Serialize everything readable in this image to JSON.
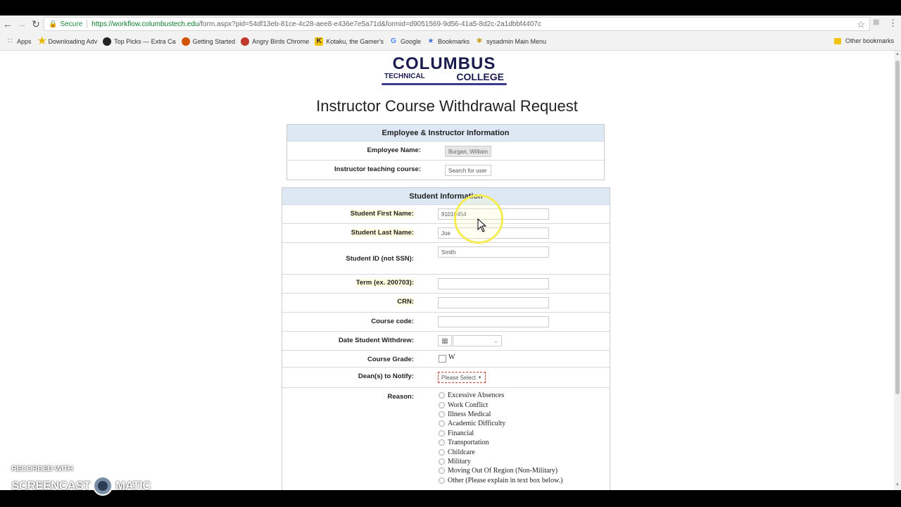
{
  "browser": {
    "secure_label": "Secure",
    "url_main": "https://workflow.columbustech.edu",
    "url_rest": "/form.aspx?pid=54df13eb-81ce-4c28-aee8-e436e7e5a71d&formid=d9051569-9d56-41a5-8d2c-2a1dbbf4407c",
    "bookmarks": [
      {
        "label": "Apps",
        "icon": "apps-grid-icon"
      },
      {
        "label": "Downloading Adv",
        "icon": "star-icon"
      },
      {
        "label": "Top Picks — Extra Ca",
        "icon": "circle-icon"
      },
      {
        "label": "Getting Started",
        "icon": "firefox-icon"
      },
      {
        "label": "Angry Birds Chrome",
        "icon": "bird-icon"
      },
      {
        "label": "Kotaku, the Gamer's",
        "icon": "kotaku-icon"
      },
      {
        "label": "Google",
        "icon": "google-icon"
      },
      {
        "label": "Bookmarks",
        "icon": "star-icon"
      },
      {
        "label": "sysadmin Main Menu",
        "icon": "sysadmin-icon"
      }
    ],
    "other_bookmarks": "Other bookmarks"
  },
  "logo": {
    "top": "COLUMBUS",
    "left": "TECHNICAL",
    "right": "COLLEGE"
  },
  "title": "Instructor Course Withdrawal Request",
  "employee_section": {
    "heading": "Employee & Instructor Information",
    "employee_name_label": "Employee Name:",
    "employee_name_value": "Burgan, William",
    "instructor_label": "Instructor teaching course:",
    "instructor_placeholder": "Search for user"
  },
  "student_section": {
    "heading": "Student Information",
    "first_name_label": "Student First Name:",
    "first_name_value": "91010454",
    "last_name_label": "Student Last Name:",
    "last_name_value": "Joe",
    "student_id_label": "Student ID (not SSN):",
    "student_id_value": "Smith",
    "term_label": "Term (ex. 200703):",
    "crn_label": "CRN:",
    "course_code_label": "Course code:",
    "date_withdrew_label": "Date Student Withdrew:",
    "course_grade_label": "Course Grade:",
    "course_grade_option": "W",
    "deans_label": "Dean(s) to Notify:",
    "deans_placeholder": "Please Select",
    "reason_label": "Reason:",
    "reasons": [
      "Excessive Absences",
      "Work Conflict",
      "Illness Medical",
      "Academic Difficulty",
      "Financial",
      "Transportation",
      "Childcare",
      "Military",
      "Moving Out Of Region (Non-Military)",
      "Other (Please explain in text box below.)"
    ]
  },
  "watermark": {
    "line1": "RECORDED WITH",
    "left": "SCREENCAST",
    "right": "MATIC"
  },
  "colors": {
    "section_header": "#dde8f4",
    "highlight": "#fffde0",
    "cursor_ring": "#f5ec52"
  }
}
